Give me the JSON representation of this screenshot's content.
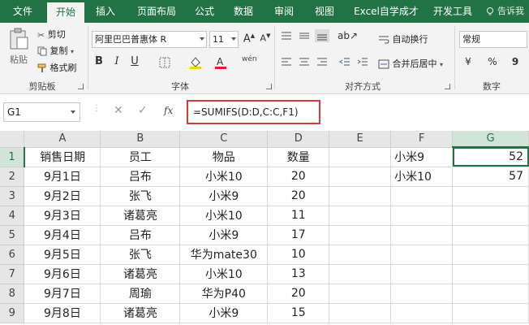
{
  "tabs": [
    "文件",
    "开始",
    "插入",
    "页面布局",
    "公式",
    "数据",
    "审阅",
    "视图",
    "Excel自学成才",
    "开发工具"
  ],
  "active_tab": "开始",
  "tell_me": "告诉我",
  "clipboard": {
    "paste": "粘贴",
    "cut": "剪切",
    "copy": "复制",
    "format_painter": "格式刷",
    "label": "剪贴板"
  },
  "font": {
    "name": "阿里巴巴普惠体 R",
    "size": "11",
    "label": "字体",
    "bold": "B",
    "italic": "I",
    "underline": "U",
    "grow": "A",
    "shrink": "A",
    "phonetic": "wén"
  },
  "alignment": {
    "wrap": "自动换行",
    "merge": "合并后居中",
    "label": "对齐方式"
  },
  "number": {
    "format": "常规",
    "label": "数字",
    "currency": "¥",
    "percent": "%",
    "comma": "9"
  },
  "accent_color": "#217346",
  "name_box": "G1",
  "formula": "=SUMIFS(D:D,C:C,F1)",
  "fx": "fx",
  "columns": [
    "A",
    "B",
    "C",
    "D",
    "E",
    "F",
    "G"
  ],
  "rows": [
    {
      "n": "1",
      "a": "销售日期",
      "b": "员工",
      "c": "物品",
      "d": "数量",
      "e": "",
      "f": "小米9",
      "g": "52"
    },
    {
      "n": "2",
      "a": "9月1日",
      "b": "吕布",
      "c": "小米10",
      "d": "20",
      "e": "",
      "f": "小米10",
      "g": "57"
    },
    {
      "n": "3",
      "a": "9月2日",
      "b": "张飞",
      "c": "小米9",
      "d": "20",
      "e": "",
      "f": "",
      "g": ""
    },
    {
      "n": "4",
      "a": "9月3日",
      "b": "诸葛亮",
      "c": "小米10",
      "d": "11",
      "e": "",
      "f": "",
      "g": ""
    },
    {
      "n": "5",
      "a": "9月4日",
      "b": "吕布",
      "c": "小米9",
      "d": "17",
      "e": "",
      "f": "",
      "g": ""
    },
    {
      "n": "6",
      "a": "9月5日",
      "b": "张飞",
      "c": "华为mate30",
      "d": "10",
      "e": "",
      "f": "",
      "g": ""
    },
    {
      "n": "7",
      "a": "9月6日",
      "b": "诸葛亮",
      "c": "小米10",
      "d": "13",
      "e": "",
      "f": "",
      "g": ""
    },
    {
      "n": "8",
      "a": "9月7日",
      "b": "周瑜",
      "c": "华为P40",
      "d": "20",
      "e": "",
      "f": "",
      "g": ""
    },
    {
      "n": "9",
      "a": "9月8日",
      "b": "诸葛亮",
      "c": "小米9",
      "d": "15",
      "e": "",
      "f": "",
      "g": ""
    }
  ]
}
